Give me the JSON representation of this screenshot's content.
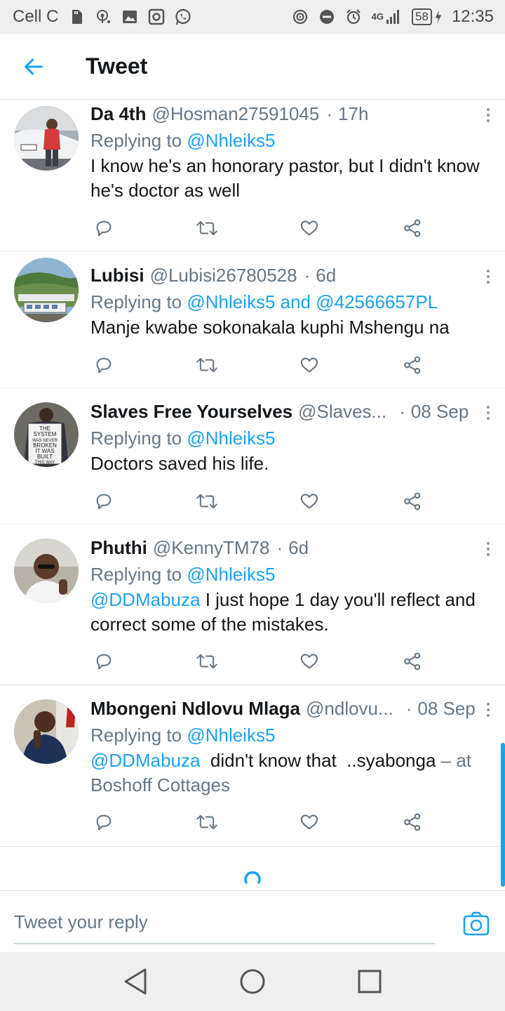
{
  "status_bar": {
    "carrier": "Cell C",
    "network": "4G",
    "battery": "58",
    "time": "12:35"
  },
  "header": {
    "title": "Tweet"
  },
  "tweets": [
    {
      "name": "Da 4th",
      "handle": "@Hosman27591045",
      "time": "17h",
      "replying_label": "Replying to",
      "replying_to": "@Nhleiks5",
      "text_lines": [
        "I know he's an honorary pastor, but I didn't know",
        "he's doctor as well"
      ]
    },
    {
      "name": "Lubisi",
      "handle": "@Lubisi26780528",
      "time": "6d",
      "replying_label": "Replying to",
      "replying_to": "@Nhleiks5 and @42566657PL",
      "text_lines": [
        "Manje kwabe sokonakala kuphi Mshengu na"
      ]
    },
    {
      "name": "Slaves Free Yourselves",
      "handle": "@Slaves...",
      "time": "08 Sep",
      "replying_label": "Replying to",
      "replying_to": "@Nhleiks5",
      "text_lines": [
        "Doctors saved his life."
      ],
      "avatar_sign": [
        "THE",
        "SYSTEM",
        "WAS NEVER",
        "BROKEN",
        "IT WAS",
        "BUILT",
        "THIS WAY"
      ]
    },
    {
      "name": "Phuthi",
      "handle": "@KennyTM78",
      "time": "6d",
      "replying_label": "Replying to",
      "replying_to": "@Nhleiks5",
      "text_mention": "@DDMabuza",
      "text_lines": [
        "I just hope 1 day you'll reflect and",
        "correct some of the mistakes."
      ]
    },
    {
      "name": "Mbongeni Ndlovu Mlaga",
      "handle": "@ndlovu...",
      "time": "08 Sep",
      "replying_label": "Replying to",
      "replying_to": "@Nhleiks5",
      "text_mention": "@DDMabuza",
      "text_lines": [
        "didn't know that  ..syabonga",
        "Boshoff Cottages"
      ],
      "location_prefix": "– at"
    }
  ],
  "reply_bar": {
    "placeholder": "Tweet your reply"
  },
  "icons": {
    "back": "arrow-left-icon",
    "more": "more-vertical-icon",
    "reply": "reply-icon",
    "retweet": "retweet-icon",
    "like": "heart-icon",
    "share": "share-icon",
    "camera": "camera-icon",
    "loading": "spinner-icon"
  },
  "colors": {
    "accent": "#1da1f2",
    "secondary_text": "#657786",
    "status_bar_bg": "#efefef"
  }
}
